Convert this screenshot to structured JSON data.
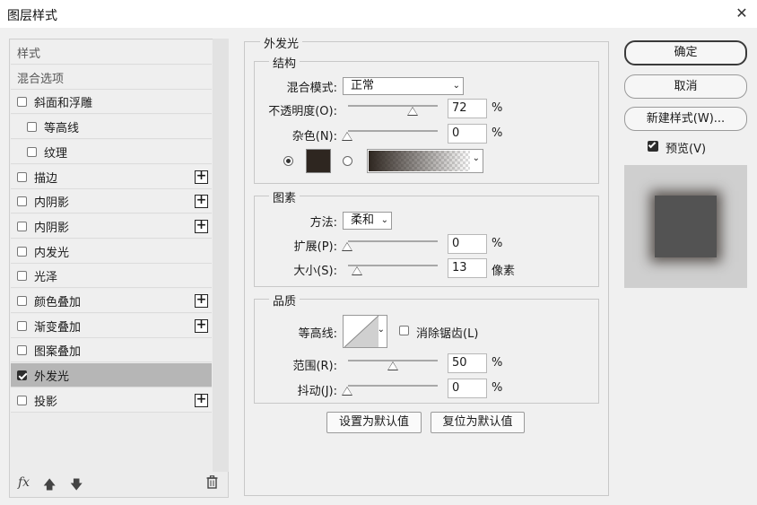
{
  "dialog": {
    "title": "图层样式",
    "close": "✕"
  },
  "left": {
    "rows": [
      {
        "label": "样式",
        "type": "header"
      },
      {
        "label": "混合选项",
        "type": "header"
      },
      {
        "label": "斜面和浮雕",
        "checked": false,
        "plus": false,
        "indent": 0
      },
      {
        "label": "等高线",
        "checked": false,
        "plus": false,
        "indent": 1
      },
      {
        "label": "纹理",
        "checked": false,
        "plus": false,
        "indent": 1
      },
      {
        "label": "描边",
        "checked": false,
        "plus": true,
        "indent": 0
      },
      {
        "label": "内阴影",
        "checked": false,
        "plus": true,
        "indent": 0
      },
      {
        "label": "内阴影",
        "checked": false,
        "plus": true,
        "indent": 0
      },
      {
        "label": "内发光",
        "checked": false,
        "plus": false,
        "indent": 0
      },
      {
        "label": "光泽",
        "checked": false,
        "plus": false,
        "indent": 0
      },
      {
        "label": "颜色叠加",
        "checked": false,
        "plus": true,
        "indent": 0
      },
      {
        "label": "渐变叠加",
        "checked": false,
        "plus": true,
        "indent": 0
      },
      {
        "label": "图案叠加",
        "checked": false,
        "plus": false,
        "indent": 0
      },
      {
        "label": "外发光",
        "checked": true,
        "plus": false,
        "indent": 0,
        "selected": true
      },
      {
        "label": "投影",
        "checked": false,
        "plus": true,
        "indent": 0
      }
    ],
    "fx": "fx",
    "up_icon": "arrow-up-icon",
    "down_icon": "arrow-down-icon",
    "trash_icon": "trash-icon"
  },
  "outer_glow": {
    "title": "外发光",
    "structure": {
      "title": "结构",
      "blend_mode_label": "混合模式:",
      "blend_mode_value": "正常",
      "opacity_label": "不透明度(O):",
      "opacity_value": "72",
      "opacity_unit": "%",
      "noise_label": "杂色(N):",
      "noise_value": "0",
      "noise_unit": "%",
      "glow_color": "#2e2620"
    },
    "elements": {
      "title": "图素",
      "method_label": "方法:",
      "method_value": "柔和",
      "spread_label": "扩展(P):",
      "spread_value": "0",
      "spread_unit": "%",
      "size_label": "大小(S):",
      "size_value": "13",
      "size_unit": "像素"
    },
    "quality": {
      "title": "品质",
      "contour_label": "等高线:",
      "antialias_label": "消除锯齿(L)",
      "range_label": "范围(R):",
      "range_value": "50",
      "range_unit": "%",
      "jitter_label": "抖动(J):",
      "jitter_value": "0",
      "jitter_unit": "%"
    },
    "make_default": "设置为默认值",
    "reset_default": "复位为默认值"
  },
  "right": {
    "ok": "确定",
    "cancel": "取消",
    "new_style": "新建样式(W)...",
    "preview_label": "预览(V)",
    "preview_checked": true
  }
}
